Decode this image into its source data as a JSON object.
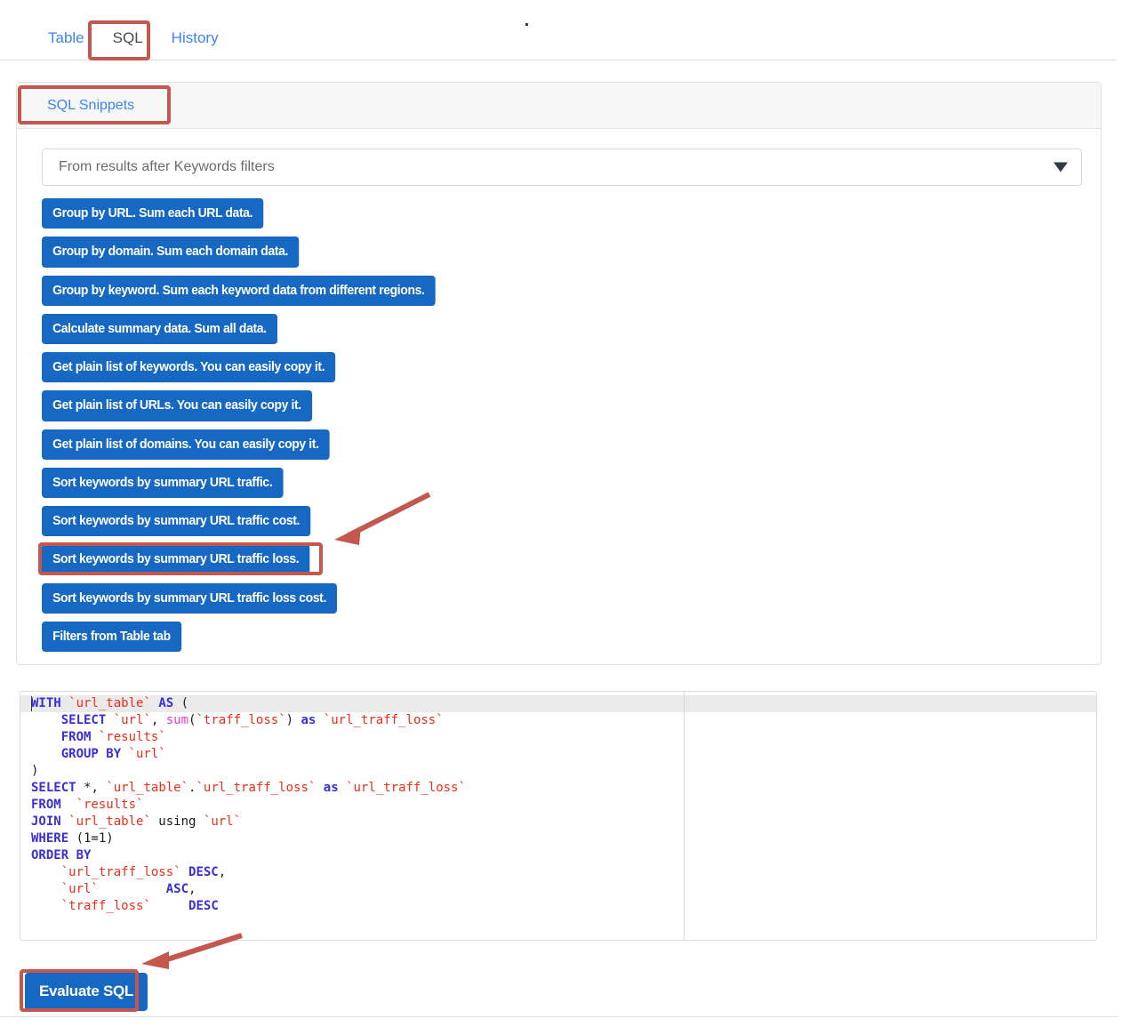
{
  "tabs": [
    {
      "label": "Table",
      "active": false
    },
    {
      "label": "SQL",
      "active": true
    },
    {
      "label": "History",
      "active": false
    }
  ],
  "snippets_panel": {
    "title": "SQL Snippets",
    "source_select": {
      "value": "From results after Keywords filters",
      "placeholder": "From results after Keywords filters",
      "options": [
        "From results after Keywords filters"
      ],
      "arrow_icon": "chevron-down-icon"
    },
    "buttons": [
      {
        "label": "Group by URL. Sum each URL data."
      },
      {
        "label": "Group by domain. Sum each domain data."
      },
      {
        "label": "Group by keyword. Sum each keyword data from different regions."
      },
      {
        "label": "Calculate summary data. Sum all data."
      },
      {
        "label": "Get plain list of keywords. You can easily copy it."
      },
      {
        "label": "Get plain list of URLs. You can easily copy it."
      },
      {
        "label": "Get plain list of domains. You can easily copy it."
      },
      {
        "label": "Sort keywords by summary URL traffic."
      },
      {
        "label": "Sort keywords by summary URL traffic cost."
      },
      {
        "label": "Sort keywords by summary URL traffic loss."
      },
      {
        "label": "Sort keywords by summary URL traffic loss cost."
      },
      {
        "label": "Filters from Table tab"
      }
    ]
  },
  "editor": {
    "lines": [
      [
        {
          "t": "WITH ",
          "c": "k"
        },
        {
          "t": "`url_table`",
          "c": "s"
        },
        {
          "t": " ",
          "c": "n"
        },
        {
          "t": "AS",
          "c": "k"
        },
        {
          "t": " (",
          "c": "n"
        }
      ],
      [
        {
          "t": "    ",
          "c": "n"
        },
        {
          "t": "SELECT ",
          "c": "k"
        },
        {
          "t": "`url`",
          "c": "s"
        },
        {
          "t": ", ",
          "c": "n"
        },
        {
          "t": "sum",
          "c": "f"
        },
        {
          "t": "(",
          "c": "n"
        },
        {
          "t": "`traff_loss`",
          "c": "s"
        },
        {
          "t": ") ",
          "c": "n"
        },
        {
          "t": "as",
          "c": "k"
        },
        {
          "t": " ",
          "c": "n"
        },
        {
          "t": "`url_traff_loss`",
          "c": "s"
        }
      ],
      [
        {
          "t": "    ",
          "c": "n"
        },
        {
          "t": "FROM ",
          "c": "k"
        },
        {
          "t": "`results`",
          "c": "s"
        }
      ],
      [
        {
          "t": "    ",
          "c": "n"
        },
        {
          "t": "GROUP BY ",
          "c": "k"
        },
        {
          "t": "`url`",
          "c": "s"
        }
      ],
      [
        {
          "t": ")",
          "c": "n"
        }
      ],
      [
        {
          "t": "SELECT ",
          "c": "k"
        },
        {
          "t": "*, ",
          "c": "n"
        },
        {
          "t": "`url_table`",
          "c": "s"
        },
        {
          "t": ".",
          "c": "n"
        },
        {
          "t": "`url_traff_loss`",
          "c": "s"
        },
        {
          "t": " ",
          "c": "n"
        },
        {
          "t": "as",
          "c": "k"
        },
        {
          "t": " ",
          "c": "n"
        },
        {
          "t": "`url_traff_loss`",
          "c": "s"
        }
      ],
      [
        {
          "t": "FROM  ",
          "c": "k"
        },
        {
          "t": "`results`",
          "c": "s"
        }
      ],
      [
        {
          "t": "JOIN ",
          "c": "k"
        },
        {
          "t": "`url_table`",
          "c": "s"
        },
        {
          "t": " using ",
          "c": "n"
        },
        {
          "t": "`url`",
          "c": "s"
        }
      ],
      [
        {
          "t": "WHERE ",
          "c": "k"
        },
        {
          "t": "(1=1)",
          "c": "n"
        }
      ],
      [
        {
          "t": "ORDER BY",
          "c": "k"
        }
      ],
      [
        {
          "t": "    ",
          "c": "n"
        },
        {
          "t": "`url_traff_loss`",
          "c": "s"
        },
        {
          "t": " ",
          "c": "n"
        },
        {
          "t": "DESC",
          "c": "k"
        },
        {
          "t": ",",
          "c": "n"
        }
      ],
      [
        {
          "t": "    ",
          "c": "n"
        },
        {
          "t": "`url`",
          "c": "s"
        },
        {
          "t": "         ",
          "c": "n"
        },
        {
          "t": "ASC",
          "c": "k"
        },
        {
          "t": ",",
          "c": "n"
        }
      ],
      [
        {
          "t": "    ",
          "c": "n"
        },
        {
          "t": "`traff_loss`",
          "c": "s"
        },
        {
          "t": "     ",
          "c": "n"
        },
        {
          "t": "DESC",
          "c": "k"
        }
      ]
    ],
    "code_text": "WITH `url_table` AS (\n    SELECT `url`, sum(`traff_loss`) as `url_traff_loss`\n    FROM `results`\n    GROUP BY `url`\n)\nSELECT *, `url_table`.`url_traff_loss` as `url_traff_loss`\nFROM  `results`\nJOIN `url_table` using `url`\nWHERE (1=1)\nORDER BY\n    `url_traff_loss` DESC,\n    `url`         ASC,\n    `traff_loss`     DESC"
  },
  "actions": {
    "evaluate_label": "Evaluate SQL"
  },
  "colors": {
    "accent_blue": "#1668c2",
    "link_blue": "#3c84f5",
    "annotation_red": "#c4584f",
    "keyword": "#3a2fd6",
    "string": "#e8301b",
    "function": "#e83fb8"
  }
}
